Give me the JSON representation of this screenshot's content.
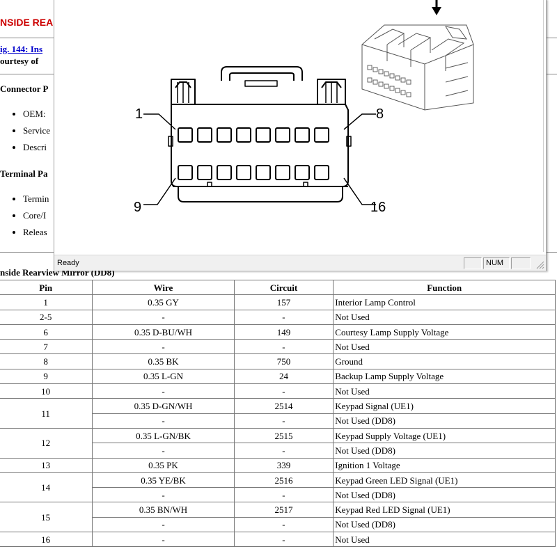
{
  "document": {
    "heading": "NSIDE REA",
    "fig_link": "ig. 144: Ins",
    "courtesy": "ourtesy of",
    "connector_section": "Connector P",
    "connector_items": [
      "OEM:",
      "Service",
      "Descri"
    ],
    "terminal_section": "Terminal Pa",
    "terminal_items": [
      "Termin",
      "Core/I",
      "Releas"
    ],
    "table_title": "nside Rearview Mirror (DD8)"
  },
  "table": {
    "headers": [
      "Pin",
      "Wire",
      "Circuit",
      "Function"
    ],
    "rows": [
      {
        "pin": "1",
        "wire": "0.35 GY",
        "circuit": "157",
        "function": "Interior Lamp Control"
      },
      {
        "pin": "2-5",
        "wire": "-",
        "circuit": "-",
        "function": "Not Used"
      },
      {
        "pin": "6",
        "wire": "0.35 D-BU/WH",
        "circuit": "149",
        "function": "Courtesy Lamp Supply Voltage"
      },
      {
        "pin": "7",
        "wire": "-",
        "circuit": "-",
        "function": "Not Used"
      },
      {
        "pin": "8",
        "wire": "0.35 BK",
        "circuit": "750",
        "function": "Ground"
      },
      {
        "pin": "9",
        "wire": "0.35 L-GN",
        "circuit": "24",
        "function": "Backup Lamp Supply Voltage"
      },
      {
        "pin": "10",
        "wire": "-",
        "circuit": "-",
        "function": "Not Used"
      },
      {
        "pin": "11",
        "wire": "0.35 D-GN/WH",
        "circuit": "2514",
        "function": "Keypad Signal (UE1)"
      },
      {
        "pin": "",
        "wire": "-",
        "circuit": "-",
        "function": "Not Used (DD8)"
      },
      {
        "pin": "12",
        "wire": "0.35 L-GN/BK",
        "circuit": "2515",
        "function": "Keypad Supply Voltage (UE1)"
      },
      {
        "pin": "",
        "wire": "-",
        "circuit": "-",
        "function": "Not Used (DD8)"
      },
      {
        "pin": "13",
        "wire": "0.35 PK",
        "circuit": "339",
        "function": "Ignition 1 Voltage"
      },
      {
        "pin": "14",
        "wire": "0.35 YE/BK",
        "circuit": "2516",
        "function": "Keypad Green LED Signal (UE1)"
      },
      {
        "pin": "",
        "wire": "-",
        "circuit": "-",
        "function": "Not Used (DD8)"
      },
      {
        "pin": "15",
        "wire": "0.35 BN/WH",
        "circuit": "2517",
        "function": "Keypad Red LED Signal (UE1)"
      },
      {
        "pin": "",
        "wire": "-",
        "circuit": "-",
        "function": "Not Used (DD8)"
      },
      {
        "pin": "16",
        "wire": "-",
        "circuit": "-",
        "function": "Not Used"
      }
    ]
  },
  "viewer": {
    "status": "Ready",
    "num_indicator": "NUM",
    "diagram_labels": {
      "pin1": "1",
      "pin8": "8",
      "pin9": "9",
      "pin16": "16"
    }
  }
}
